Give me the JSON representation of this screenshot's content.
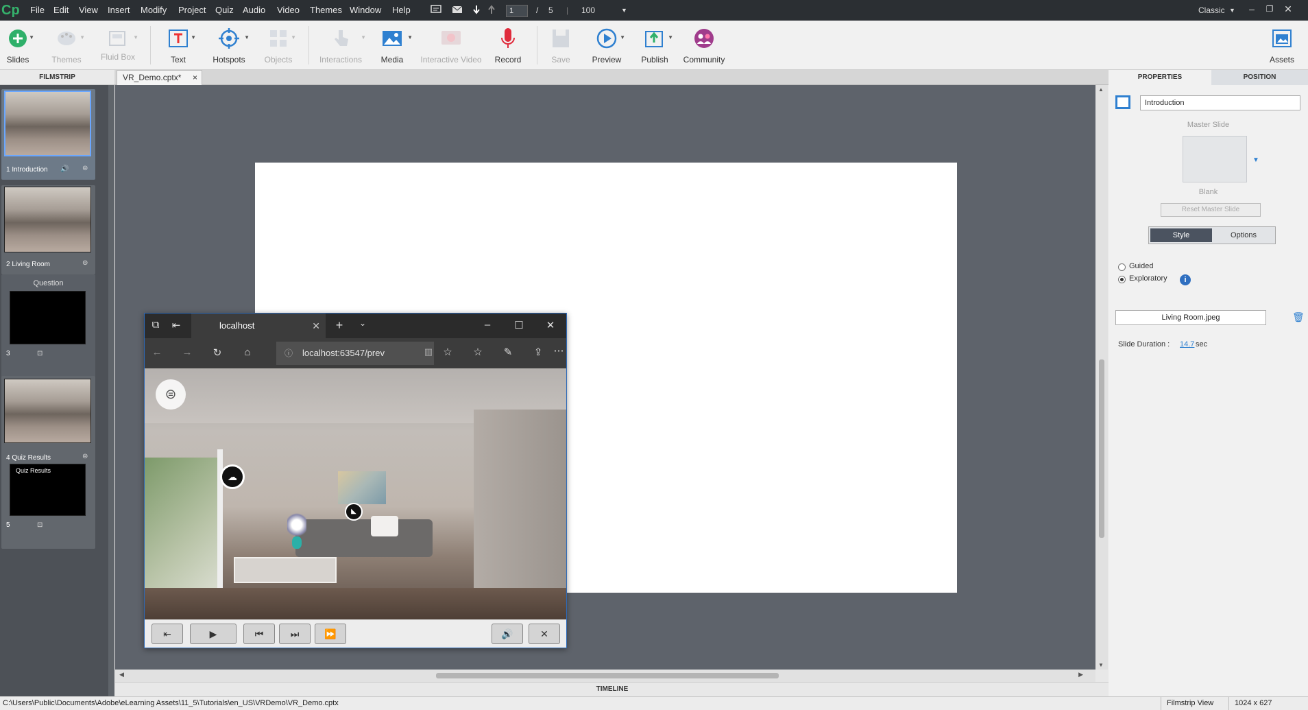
{
  "app": {
    "logo": "Cp",
    "workspace": "Classic"
  },
  "menu": [
    "File",
    "Edit",
    "View",
    "Insert",
    "Modify",
    "Project",
    "Quiz",
    "Audio",
    "Video",
    "Themes",
    "Window",
    "Help"
  ],
  "nav": {
    "current_slide": "1",
    "separator": "/",
    "total_slides": "5",
    "zoom": "100"
  },
  "toolbar": [
    {
      "label": "Slides",
      "enabled": true
    },
    {
      "label": "Themes",
      "enabled": false
    },
    {
      "label": "Fluid Box",
      "enabled": false
    },
    {
      "label": "Text",
      "enabled": true
    },
    {
      "label": "Hotspots",
      "enabled": true
    },
    {
      "label": "Objects",
      "enabled": false
    },
    {
      "label": "Interactions",
      "enabled": false
    },
    {
      "label": "Media",
      "enabled": true
    },
    {
      "label": "Interactive Video",
      "enabled": false
    },
    {
      "label": "Record",
      "enabled": true
    },
    {
      "label": "Save",
      "enabled": false
    },
    {
      "label": "Preview",
      "enabled": true
    },
    {
      "label": "Publish",
      "enabled": true
    },
    {
      "label": "Community",
      "enabled": true
    },
    {
      "label": "Assets",
      "enabled": true
    }
  ],
  "filmstrip": {
    "header": "FILMSTRIP",
    "slides": [
      {
        "label": "1 Introduction"
      },
      {
        "label": "2 Living Room"
      },
      {
        "label": "3"
      },
      {
        "label": "4 Quiz Results"
      },
      {
        "label": "5"
      }
    ],
    "question_label": "Question",
    "quiz_thumb_title": "Quiz Results"
  },
  "document": {
    "tab_title": "VR_Demo.cptx*",
    "close": "×"
  },
  "browser": {
    "tab_title": "localhost",
    "address": "localhost:63547/prev"
  },
  "properties": {
    "tabs": [
      "PROPERTIES",
      "POSITION"
    ],
    "slide_name": "Introduction",
    "master_slide_label": "Master Slide",
    "master_slide_value": "Blank",
    "reset_master_button": "Reset Master Slide",
    "style_tab": "Style",
    "options_tab": "Options",
    "mode_guided": "Guided",
    "mode_exploratory": "Exploratory",
    "selected_mode": "Exploratory",
    "image_file": "Living Room.jpeg",
    "duration_label": "Slide Duration :",
    "duration_value": "14.7",
    "duration_unit": "sec"
  },
  "timeline": {
    "label": "TIMELINE"
  },
  "status": {
    "path": "C:\\Users\\Public\\Documents\\Adobe\\eLearning Assets\\11_5\\Tutorials\\en_US\\VRDemo\\VR_Demo.cptx",
    "view": "Filmstrip View",
    "dimensions": "1024 x 627"
  },
  "colors": {
    "accent": "#2f80d0",
    "menubar": "#2b2f33",
    "canvas": "#5e636b",
    "filmstrip": "#4d5157"
  }
}
